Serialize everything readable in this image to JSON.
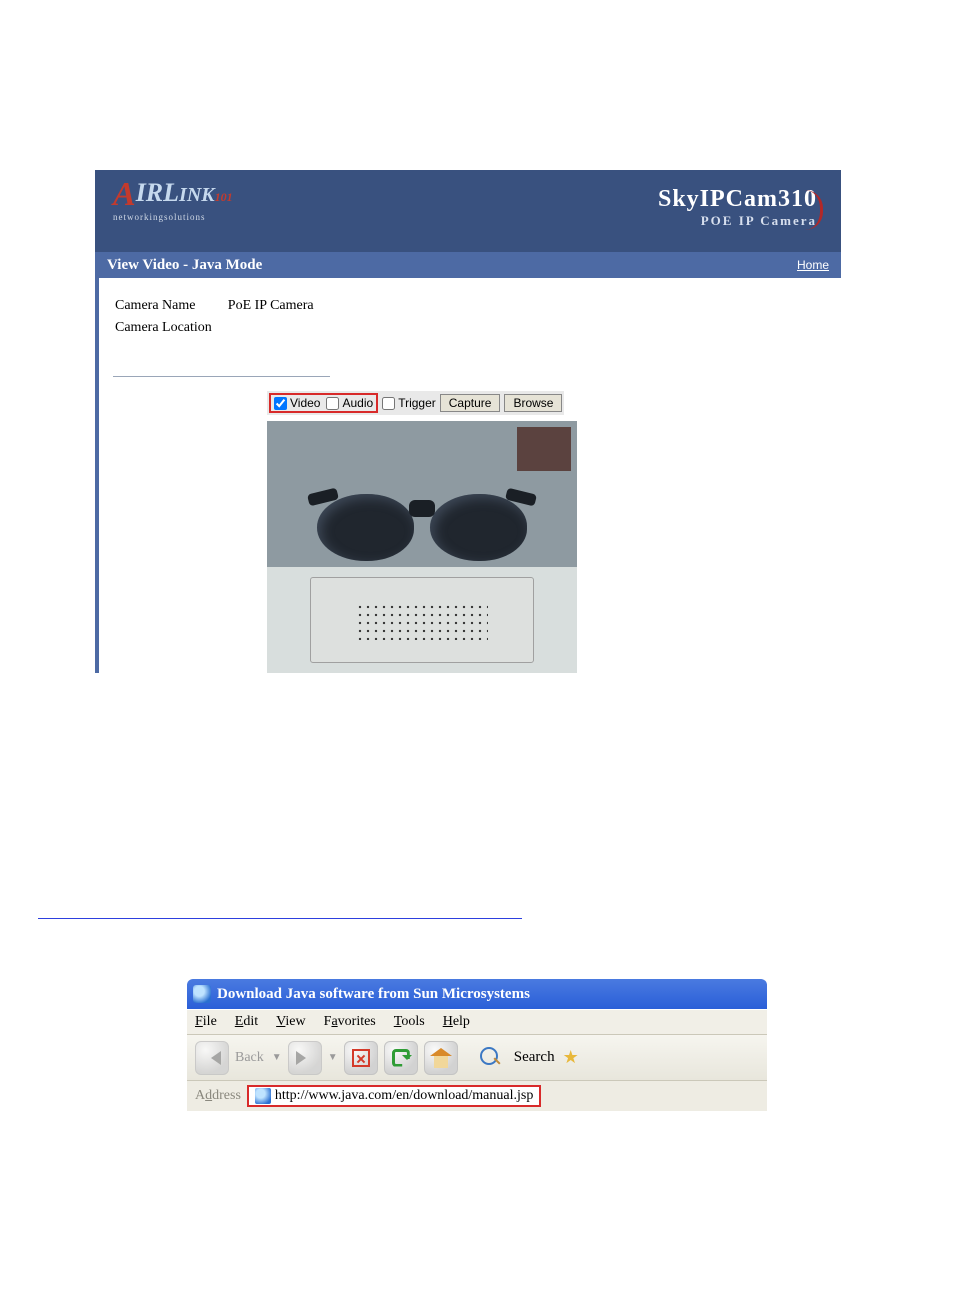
{
  "camera_ui": {
    "logo_text": "AIRLINK 101",
    "logo_tag": "networkingsolutions",
    "product_name": "SkyIPCam310",
    "product_sub": "POE IP Camera",
    "page_title": "View Video - Java Mode",
    "home_link": "Home",
    "info": {
      "name_label": "Camera Name",
      "name_value": "PoE IP Camera",
      "location_label": "Camera Location",
      "location_value": ""
    },
    "controls": {
      "video_label": "Video",
      "video_checked": true,
      "audio_label": "Audio",
      "audio_checked": false,
      "trigger_label": "Trigger",
      "trigger_checked": false,
      "capture_label": "Capture",
      "browse_label": "Browse"
    }
  },
  "ie": {
    "title": "Download Java software from Sun Microsystems",
    "menu": {
      "file": "File",
      "edit": "Edit",
      "view": "View",
      "favorites": "Favorites",
      "tools": "Tools",
      "help": "Help"
    },
    "toolbar": {
      "back": "Back",
      "search": "Search"
    },
    "address_label": "Address",
    "address_value": "http://www.java.com/en/download/manual.jsp"
  }
}
